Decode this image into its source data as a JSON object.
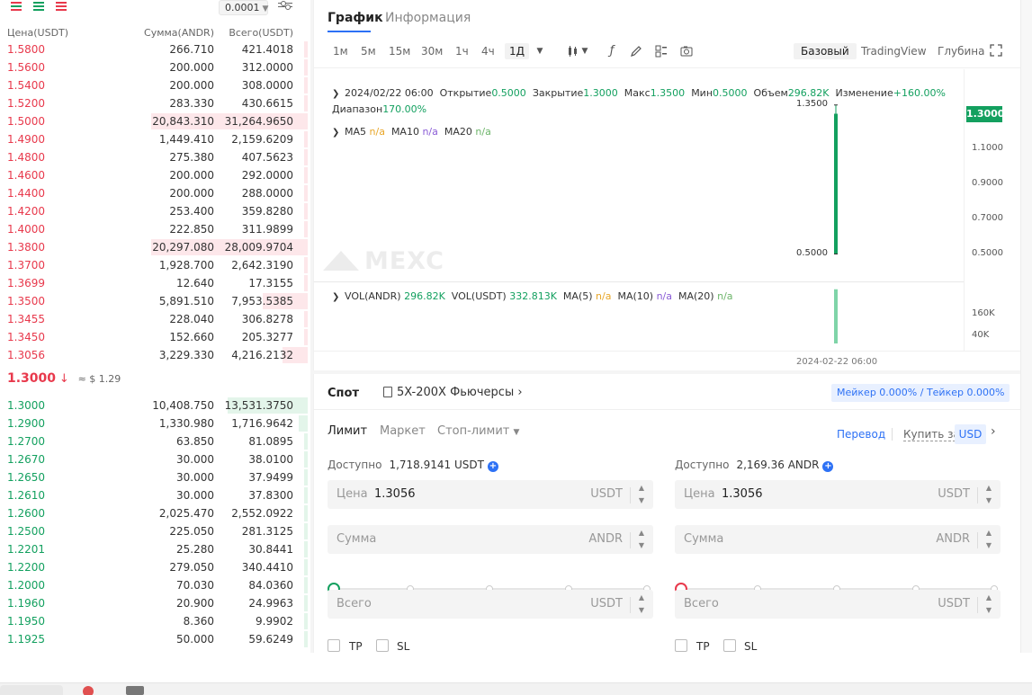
{
  "colors": {
    "up": "#13a05f",
    "down": "#e8394c",
    "accent": "#2d71f5",
    "volume": "#7fd4a8"
  },
  "orderbook": {
    "precision": "0.0001",
    "headers": {
      "price": "Цена(USDT)",
      "amount": "Сумма(ANDR)",
      "total": "Всего(USDT)"
    },
    "asks": [
      {
        "price": "1.5800",
        "amount": "266.710",
        "total": "421.4018",
        "depth": 0.01
      },
      {
        "price": "1.5600",
        "amount": "200.000",
        "total": "312.0000",
        "depth": 0.01
      },
      {
        "price": "1.5400",
        "amount": "200.000",
        "total": "308.0000",
        "depth": 0.01
      },
      {
        "price": "1.5200",
        "amount": "283.330",
        "total": "430.6615",
        "depth": 0.01
      },
      {
        "price": "1.5000",
        "amount": "20,843.310",
        "total": "31,264.9650",
        "depth": 1.0
      },
      {
        "price": "1.4900",
        "amount": "1,449.410",
        "total": "2,159.6209",
        "depth": 0.01
      },
      {
        "price": "1.4800",
        "amount": "275.380",
        "total": "407.5623",
        "depth": 0.01
      },
      {
        "price": "1.4600",
        "amount": "200.000",
        "total": "292.0000",
        "depth": 0.01
      },
      {
        "price": "1.4400",
        "amount": "200.000",
        "total": "288.0000",
        "depth": 0.01
      },
      {
        "price": "1.4200",
        "amount": "253.400",
        "total": "359.8280",
        "depth": 0.01
      },
      {
        "price": "1.4000",
        "amount": "222.850",
        "total": "311.9899",
        "depth": 0.01
      },
      {
        "price": "1.3800",
        "amount": "20,297.080",
        "total": "28,009.9704",
        "depth": 1.0
      },
      {
        "price": "1.3700",
        "amount": "1,928.700",
        "total": "2,642.3190",
        "depth": 0.01
      },
      {
        "price": "1.3699",
        "amount": "12.640",
        "total": "17.3155",
        "depth": 0.01
      },
      {
        "price": "1.3500",
        "amount": "5,891.510",
        "total": "7,953.5385",
        "depth": 0.29
      },
      {
        "price": "1.3455",
        "amount": "228.040",
        "total": "306.8278",
        "depth": 0.01
      },
      {
        "price": "1.3450",
        "amount": "152.660",
        "total": "205.3277",
        "depth": 0.01
      },
      {
        "price": "1.3056",
        "amount": "3,229.330",
        "total": "4,216.2132",
        "depth": 0.16
      }
    ],
    "last_price": "1.3000",
    "last_arrow": "↓",
    "last_usd": "≈ $ 1.29",
    "bids": [
      {
        "price": "1.3000",
        "amount": "10,408.750",
        "total": "13,531.3750",
        "depth": 0.51
      },
      {
        "price": "1.2900",
        "amount": "1,330.980",
        "total": "1,716.9642",
        "depth": 0.06
      },
      {
        "price": "1.2700",
        "amount": "63.850",
        "total": "81.0895",
        "depth": 0.01
      },
      {
        "price": "1.2670",
        "amount": "30.000",
        "total": "38.0100",
        "depth": 0.01
      },
      {
        "price": "1.2650",
        "amount": "30.000",
        "total": "37.9499",
        "depth": 0.01
      },
      {
        "price": "1.2610",
        "amount": "30.000",
        "total": "37.8300",
        "depth": 0.01
      },
      {
        "price": "1.2600",
        "amount": "2,025.470",
        "total": "2,552.0922",
        "depth": 0.02
      },
      {
        "price": "1.2500",
        "amount": "225.050",
        "total": "281.3125",
        "depth": 0.01
      },
      {
        "price": "1.2201",
        "amount": "25.280",
        "total": "30.8441",
        "depth": 0.01
      },
      {
        "price": "1.2200",
        "amount": "279.050",
        "total": "340.4410",
        "depth": 0.01
      },
      {
        "price": "1.2000",
        "amount": "70.030",
        "total": "84.0360",
        "depth": 0.01
      },
      {
        "price": "1.1960",
        "amount": "20.900",
        "total": "24.9963",
        "depth": 0.01
      },
      {
        "price": "1.1950",
        "amount": "8.360",
        "total": "9.9902",
        "depth": 0.01
      },
      {
        "price": "1.1925",
        "amount": "50.000",
        "total": "59.6249",
        "depth": 0.01
      }
    ]
  },
  "chart": {
    "tabs": [
      "График",
      "Информация"
    ],
    "intervals": [
      "1м",
      "5м",
      "15м",
      "30м",
      "1ч",
      "4ч",
      "1Д"
    ],
    "selected_interval": "1Д",
    "views": [
      "Базовый",
      "TradingView",
      "Глубина"
    ],
    "selected_view": "Базовый",
    "ohlc": {
      "date": "2024/02/22 06:00",
      "open_label": "Открытие",
      "open": "0.5000",
      "close_label": "Закрытие",
      "close": "1.3000",
      "high_label": "Макс",
      "high": "1.3500",
      "low_label": "Мин",
      "low": "0.5000",
      "vol_label": "Объем",
      "vol": "296.82K",
      "change_label": "Изменение",
      "change": "+160.00%",
      "range_label": "Диапазон",
      "range": "170.00%"
    },
    "ma": {
      "ma5": "MA5",
      "ma10": "MA10",
      "ma20": "MA20",
      "na": "n/a"
    },
    "vol": {
      "vol_andr_label": "VOL(ANDR)",
      "vol_andr": "296.82K",
      "vol_usdt_label": "VOL(USDT)",
      "vol_usdt": "332.813K",
      "ma5": "MA(5)",
      "ma10": "MA(10)",
      "ma20": "MA(20)",
      "na": "n/a"
    },
    "price_ticks": [
      "1.1000",
      "0.9000",
      "0.7000",
      "0.5000"
    ],
    "volume_ticks": [
      "160K",
      "40K"
    ],
    "current_price_tag": "1.3000",
    "high_marker": "1.3500",
    "low_marker": "0.5000",
    "date_tick": "2024-02-22 06:00",
    "watermark": "MEXC"
  },
  "chart_data": {
    "type": "candlestick",
    "x": [
      "2024-02-22 06:00"
    ],
    "open": [
      0.5
    ],
    "high": [
      1.35
    ],
    "low": [
      0.5
    ],
    "close": [
      1.3
    ],
    "volume": [
      296820
    ],
    "ylim": [
      0.4,
      1.4
    ],
    "volume_ylim": [
      0,
      330000
    ]
  },
  "trade": {
    "spot": "Спот",
    "futures": "5X-200X Фьючерсы",
    "fee": "Мейкер 0.000% / Тейкер 0.000%",
    "types": [
      "Лимит",
      "Маркет",
      "Стоп-лимит"
    ],
    "selected_type": "Лимит",
    "transfer": "Перевод",
    "buy_with": "Купить за",
    "currency": "USD",
    "buy": {
      "avail_label": "Доступно",
      "avail_value": "1,718.9141 USDT",
      "price_label": "Цена",
      "price_value": "1.3056",
      "price_unit": "USDT",
      "amount_label": "Сумма",
      "amount_unit": "ANDR",
      "total_label": "Всего",
      "total_unit": "USDT",
      "tp": "TP",
      "sl": "SL"
    },
    "sell": {
      "avail_label": "Доступно",
      "avail_value": "2,169.36 ANDR",
      "price_label": "Цена",
      "price_value": "1.3056",
      "price_unit": "USDT",
      "amount_label": "Сумма",
      "amount_unit": "ANDR",
      "total_label": "Всего",
      "total_unit": "USDT",
      "tp": "TP",
      "sl": "SL"
    }
  }
}
